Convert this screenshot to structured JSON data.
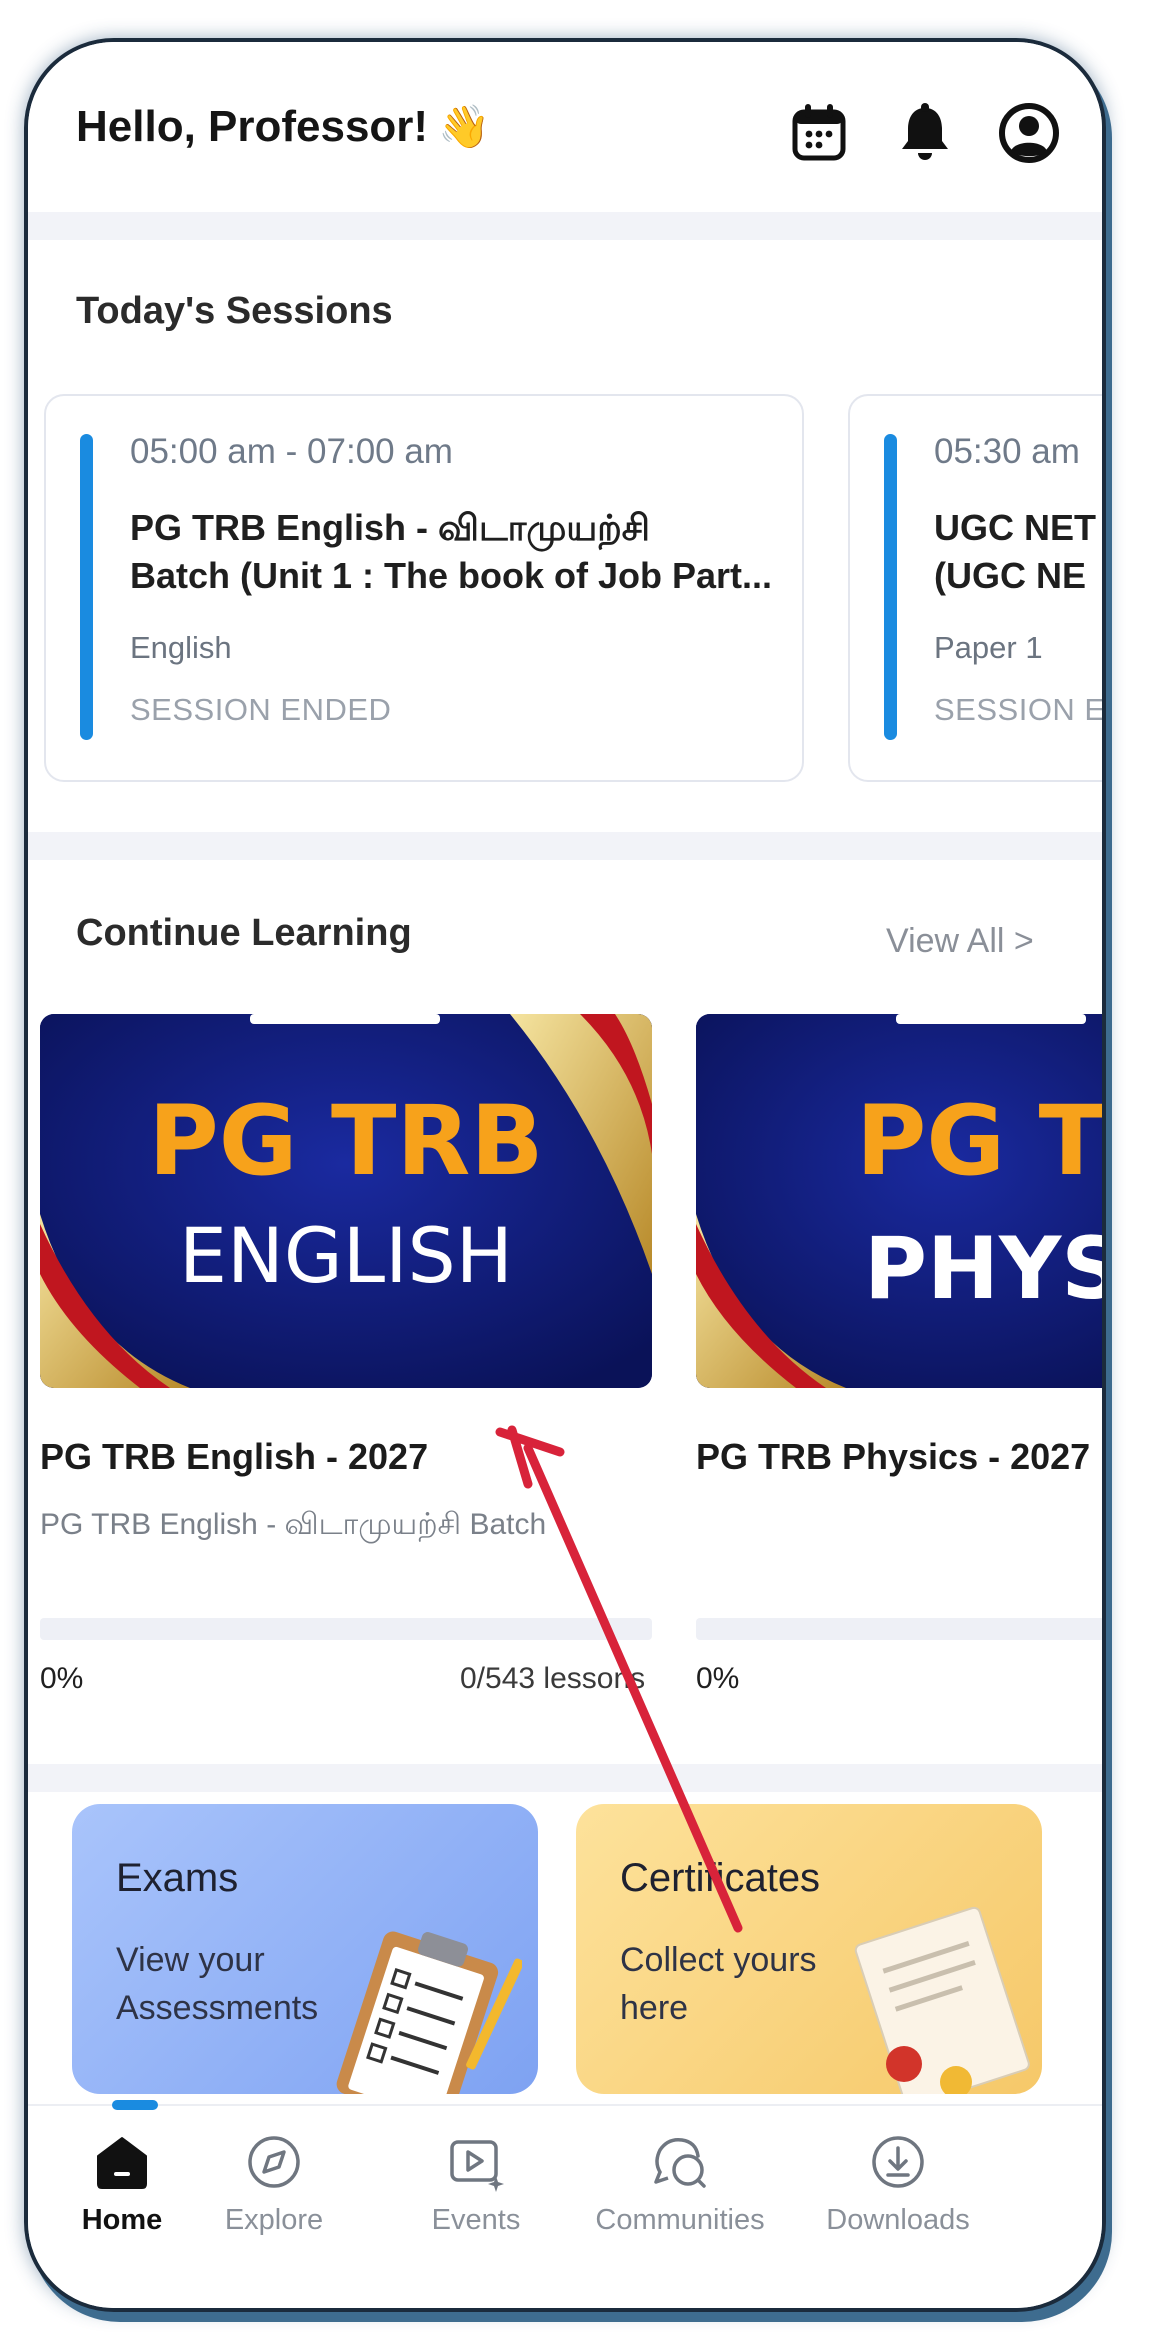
{
  "header": {
    "greeting": "Hello, Professor!",
    "wave_emoji": "👋",
    "icons": [
      "calendar-icon",
      "bell-icon",
      "profile-icon"
    ]
  },
  "sessions": {
    "title": "Today's Sessions",
    "items": [
      {
        "time": "05:00 am - 07:00 am",
        "title_line1": "PG TRB English - விடாமுயற்சி",
        "title_line2": "Batch  (Unit 1 : The book of Job Part...",
        "subject": "English",
        "status": "SESSION ENDED"
      },
      {
        "time": "05:30 am",
        "title_line1": "UGC NET",
        "title_line2": "(UGC NE",
        "subject": "Paper 1",
        "status": "SESSION E"
      }
    ]
  },
  "continue_learning": {
    "title": "Continue Learning",
    "view_all": "View All >",
    "courses": [
      {
        "thumb_line1": "PG TRB",
        "thumb_line2": "ENGLISH",
        "title": "PG TRB English - 2027",
        "subtitle": "PG TRB English - விடாமுயற்சி Batch",
        "progress_pct": "0%",
        "progress_value": 0,
        "lessons": "0/543 lessons"
      },
      {
        "thumb_line1": "PG TR",
        "thumb_line2": "PHYSIC",
        "title": "PG TRB Physics - 2027",
        "subtitle": "",
        "progress_pct": "0%",
        "progress_value": 0,
        "lessons": ""
      }
    ]
  },
  "promos": [
    {
      "title": "Exams",
      "subtitle": "View your Assessments",
      "color": "#8fb0f6"
    },
    {
      "title": "Certificates",
      "subtitle": "Collect yours here",
      "color": "#f9d27e"
    }
  ],
  "nav": {
    "items": [
      {
        "label": "Home",
        "icon": "home-icon",
        "active": true
      },
      {
        "label": "Explore",
        "icon": "compass-icon",
        "active": false
      },
      {
        "label": "Events",
        "icon": "events-icon",
        "active": false
      },
      {
        "label": "Communities",
        "icon": "communities-icon",
        "active": false
      },
      {
        "label": "Downloads",
        "icon": "download-icon",
        "active": false
      }
    ]
  },
  "colors": {
    "accent": "#1a8be0",
    "annotation_arrow": "#d8233a",
    "thumb_navy": "#0f1a6b",
    "thumb_orange": "#f7a21b"
  }
}
